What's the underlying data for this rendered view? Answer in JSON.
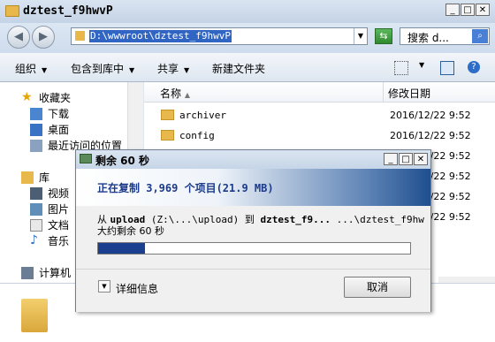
{
  "window": {
    "title": "dztest_f9hwvP"
  },
  "address": {
    "path": "D:\\wwwroot\\dztest_f9hwvP",
    "search_label": "搜索 d..."
  },
  "toolbar": {
    "organize": "组织",
    "include": "包含到库中",
    "share": "共享",
    "new_folder": "新建文件夹"
  },
  "nav": {
    "favorites": "收藏夹",
    "downloads": "下载",
    "desktop": "桌面",
    "recent": "最近访问的位置",
    "libraries": "库",
    "videos": "视频",
    "pictures": "图片",
    "documents": "文档",
    "music": "音乐",
    "computer": "计算机"
  },
  "columns": {
    "name": "名称",
    "modified": "修改日期"
  },
  "files": [
    {
      "name": "archiver",
      "date": "2016/12/22 9:52"
    },
    {
      "name": "config",
      "date": "2016/12/22 9:52"
    },
    {
      "name": "",
      "date": "2016/12/22 9:52"
    },
    {
      "name": "",
      "date": "2016/12/22 9:52"
    },
    {
      "name": "",
      "date": "2016/12/22 9:52"
    },
    {
      "name": "",
      "date": "2016/12/22 9:52"
    }
  ],
  "dialog": {
    "title": "剩余 60 秒",
    "header": "正在复制 3,969 个项目(21.9 MB)",
    "from_prefix": "从 ",
    "source": "upload",
    "source_path": " (Z:\\...\\upload) 到 ",
    "dest": "dztest_f9...",
    "dest_path": "  ...\\dztest_f9hw",
    "remaining": "大约剩余 60 秒",
    "progress_fraction": 0.15,
    "more_info": "详细信息",
    "cancel": "取消"
  },
  "colors": {
    "progress": "#1a3f8f",
    "header_gradient_end": "#1f4f8f",
    "selection": "#3165c4"
  }
}
